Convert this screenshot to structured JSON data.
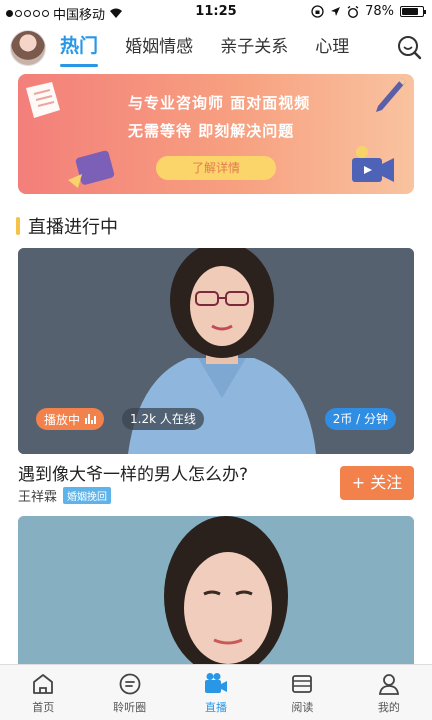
{
  "status_bar": {
    "carrier": "中国移动",
    "time": "11:25",
    "battery": "78%",
    "battery_level": 0.78
  },
  "header": {
    "tabs": [
      "热门",
      "婚姻情感",
      "亲子关系",
      "心理"
    ],
    "active_tab": 0,
    "search_icon": "search-icon"
  },
  "banner": {
    "line1": "与专业咨询师  面对面视频",
    "line2": "无需等待  即刻解决问题",
    "button": "了解详情"
  },
  "section": {
    "title": "直播进行中"
  },
  "live": {
    "status": "播放中",
    "viewers": "1.2k 人在线",
    "price": "2币 / 分钟",
    "title": "遇到像大爷一样的男人怎么办?",
    "host": "王祥霖",
    "tag": "婚姻挽回",
    "follow": "+ 关注"
  },
  "bottom_nav": [
    {
      "label": "首页",
      "icon": "home-icon"
    },
    {
      "label": "聆听圈",
      "icon": "chat-icon"
    },
    {
      "label": "直播",
      "icon": "camera-icon"
    },
    {
      "label": "阅读",
      "icon": "book-icon"
    },
    {
      "label": "我的",
      "icon": "profile-icon"
    }
  ],
  "colors": {
    "accent": "#2a97e6",
    "orange": "#f2814b",
    "section_bar": "#f6c34a"
  }
}
